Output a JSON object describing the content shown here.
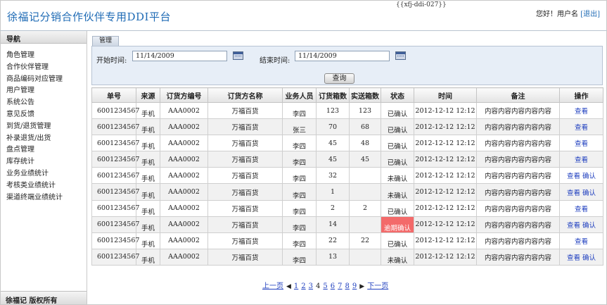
{
  "header": {
    "title": "徐福记分销合作伙伴专用DDI平台",
    "code": "{{xfj-ddi-027}}",
    "greeting": "您好！用户名",
    "logout": "[退出]"
  },
  "nav": {
    "heading": "导航",
    "items": [
      "角色管理",
      "合作伙伴管理",
      "商品编码对应管理",
      "用户管理",
      "系统公告",
      "意见反馈",
      "到货/退货管理",
      "补录退货/出货",
      "盘点管理",
      "库存统计",
      "业务业绩统计",
      "考核类业绩统计",
      "渠道终端业绩统计"
    ],
    "footer": "徐福记 版权所有"
  },
  "tab": {
    "label": "管理"
  },
  "filter": {
    "start_label": "开始时间:",
    "start_value": "11/14/2009",
    "end_label": "结束时间:",
    "end_value": "11/14/2009",
    "query_label": "查询"
  },
  "table": {
    "headers": [
      "单号",
      "来源",
      "订货方编号",
      "订货方名称",
      "业务人员",
      "订货箱数",
      "实送箱数",
      "状态",
      "时间",
      "备注",
      "操作"
    ],
    "rows": [
      {
        "id": "6001234567",
        "src": "手机",
        "cust_no": "AAA0002",
        "cust_name": "万福百货",
        "sales": "李四",
        "ordered": "123",
        "delivered": "123",
        "status": "已确认",
        "time": "2012-12-12 12:12",
        "note": "内容内容内容内容内容",
        "ops": [
          "查看"
        ]
      },
      {
        "id": "6001234567",
        "src": "手机",
        "cust_no": "AAA0002",
        "cust_name": "万福百货",
        "sales": "张三",
        "ordered": "70",
        "delivered": "68",
        "status": "已确认",
        "time": "2012-12-12 12:12",
        "note": "内容内容内容内容内容",
        "ops": [
          "查看"
        ]
      },
      {
        "id": "6001234567",
        "src": "手机",
        "cust_no": "AAA0002",
        "cust_name": "万福百货",
        "sales": "李四",
        "ordered": "45",
        "delivered": "48",
        "status": "已确认",
        "time": "2012-12-12 12:12",
        "note": "内容内容内容内容内容",
        "ops": [
          "查看"
        ]
      },
      {
        "id": "6001234567",
        "src": "手机",
        "cust_no": "AAA0002",
        "cust_name": "万福百货",
        "sales": "李四",
        "ordered": "45",
        "delivered": "45",
        "status": "已确认",
        "time": "2012-12-12 12:12",
        "note": "内容内容内容内容内容",
        "ops": [
          "查看"
        ]
      },
      {
        "id": "6001234567",
        "src": "手机",
        "cust_no": "AAA0002",
        "cust_name": "万福百货",
        "sales": "李四",
        "ordered": "32",
        "delivered": "",
        "status": "未确认",
        "time": "2012-12-12 12:12",
        "note": "内容内容内容内容内容",
        "ops": [
          "查看",
          "确认"
        ]
      },
      {
        "id": "6001234567",
        "src": "手机",
        "cust_no": "AAA0002",
        "cust_name": "万福百货",
        "sales": "李四",
        "ordered": "1",
        "delivered": "",
        "status": "未确认",
        "time": "2012-12-12 12:12",
        "note": "内容内容内容内容内容",
        "ops": [
          "查看",
          "确认"
        ]
      },
      {
        "id": "6001234567",
        "src": "手机",
        "cust_no": "AAA0002",
        "cust_name": "万福百货",
        "sales": "李四",
        "ordered": "2",
        "delivered": "2",
        "status": "已确认",
        "time": "2012-12-12 12:12",
        "note": "内容内容内容内容内容",
        "ops": [
          "查看"
        ]
      },
      {
        "id": "6001234567",
        "src": "手机",
        "cust_no": "AAA0002",
        "cust_name": "万福百货",
        "sales": "李四",
        "ordered": "14",
        "delivered": "",
        "status": "逾期确认",
        "time": "2012-12-12 12:12",
        "note": "内容内容内容内容内容",
        "ops": [
          "查看",
          "确认"
        ],
        "overdue": true
      },
      {
        "id": "6001234567",
        "src": "手机",
        "cust_no": "AAA0002",
        "cust_name": "万福百货",
        "sales": "李四",
        "ordered": "22",
        "delivered": "22",
        "status": "已确认",
        "time": "2012-12-12 12:12",
        "note": "内容内容内容内容内容",
        "ops": [
          "查看"
        ]
      },
      {
        "id": "6001234567",
        "src": "手机",
        "cust_no": "AAA0002",
        "cust_name": "万福百货",
        "sales": "李四",
        "ordered": "13",
        "delivered": "",
        "status": "未确认",
        "time": "2012-12-12 12:12",
        "note": "内容内容内容内容内容",
        "ops": [
          "查看",
          "确认"
        ]
      }
    ]
  },
  "pager": {
    "prev": "上一页",
    "next": "下一页",
    "pages": [
      "1",
      "2",
      "3",
      "4",
      "5",
      "6",
      "7",
      "8",
      "9"
    ],
    "current": "4"
  },
  "colors": {
    "title": "#1f6bb5",
    "link": "#1f3fbf",
    "overdue_bg": "#f36a6a",
    "toolbar_bg": "#e7eef7"
  },
  "icons": {
    "calendar": "calendar-icon",
    "prev_arrow": "triangle-left-icon",
    "next_arrow": "triangle-right-icon"
  }
}
